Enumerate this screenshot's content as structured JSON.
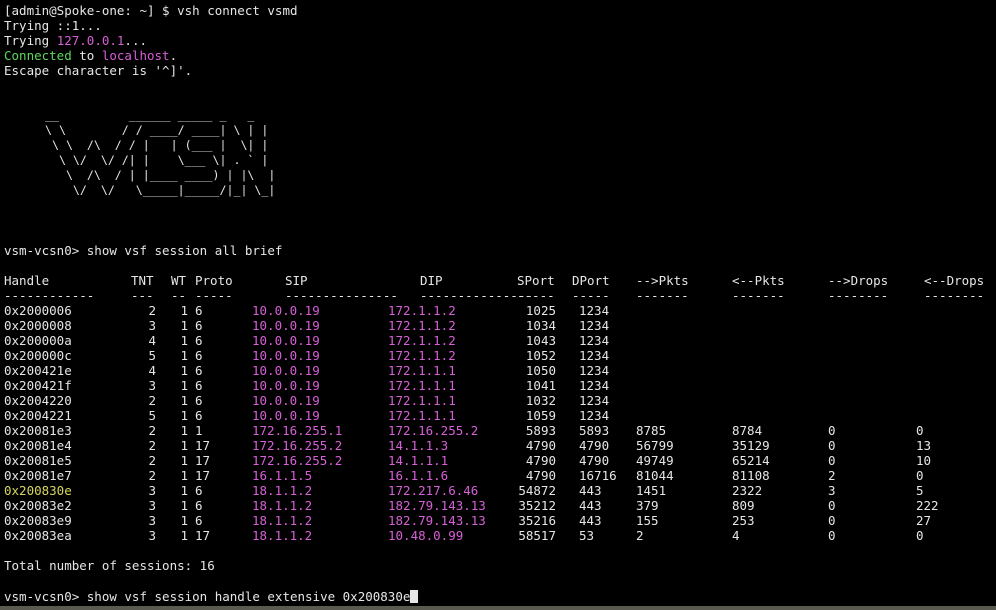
{
  "preamble": {
    "prompt": "[admin@Spoke-one: ~] $ vsh connect vsmd",
    "trying1": "Trying ::1...",
    "trying2_prefix": "Trying ",
    "trying2_ip": "127.0.0.1",
    "trying2_suffix": "...",
    "connected": "Connected",
    "connected_to": " to ",
    "localhost": "localhost",
    "period": ".",
    "escape": "Escape character is '^]'."
  },
  "banner": "__          ______ _____ _   _\n\\ \\        / / ____/ ____| \\ | |\n \\ \\  /\\  / / |   | (___ |  \\| |\n  \\ \\/  \\/ /| |    \\___ \\| . ` |\n   \\  /\\  / | |____ ____) | |\\  |\n    \\/  \\/   \\_____|_____/|_| \\_|",
  "command1": "vsm-vcsn0> show vsf session all brief",
  "table": {
    "headers": [
      "Handle",
      "TNT",
      "WT",
      "Proto",
      "SIP",
      "DIP",
      "SPort",
      "DPort",
      "-->Pkts",
      "<--Pkts",
      "-->Drops",
      "<--Drops"
    ],
    "separators": [
      "------------",
      "---",
      "--",
      "-----",
      "---------------",
      "---------------",
      "-----",
      "-----",
      "-------",
      "-------",
      "--------",
      "--------"
    ],
    "rows": [
      [
        "0x2000006",
        "2",
        "1",
        "6",
        "10.0.0.19",
        "172.1.1.2",
        "1025",
        "1234",
        "",
        "",
        "",
        ""
      ],
      [
        "0x2000008",
        "3",
        "1",
        "6",
        "10.0.0.19",
        "172.1.1.2",
        "1034",
        "1234",
        "",
        "",
        "",
        ""
      ],
      [
        "0x200000a",
        "4",
        "1",
        "6",
        "10.0.0.19",
        "172.1.1.2",
        "1043",
        "1234",
        "",
        "",
        "",
        ""
      ],
      [
        "0x200000c",
        "5",
        "1",
        "6",
        "10.0.0.19",
        "172.1.1.2",
        "1052",
        "1234",
        "",
        "",
        "",
        ""
      ],
      [
        "0x200421e",
        "4",
        "1",
        "6",
        "10.0.0.19",
        "172.1.1.1",
        "1050",
        "1234",
        "",
        "",
        "",
        ""
      ],
      [
        "0x200421f",
        "3",
        "1",
        "6",
        "10.0.0.19",
        "172.1.1.1",
        "1041",
        "1234",
        "",
        "",
        "",
        ""
      ],
      [
        "0x2004220",
        "2",
        "1",
        "6",
        "10.0.0.19",
        "172.1.1.1",
        "1032",
        "1234",
        "",
        "",
        "",
        ""
      ],
      [
        "0x2004221",
        "5",
        "1",
        "6",
        "10.0.0.19",
        "172.1.1.1",
        "1059",
        "1234",
        "",
        "",
        "",
        ""
      ],
      [
        "0x20081e3",
        "2",
        "1",
        "1",
        "172.16.255.1",
        "172.16.255.2",
        "5893",
        "5893",
        "8785",
        "8784",
        "0",
        "0"
      ],
      [
        "0x20081e4",
        "2",
        "1",
        "17",
        "172.16.255.2",
        "14.1.1.3",
        "4790",
        "4790",
        "56799",
        "35129",
        "0",
        "13"
      ],
      [
        "0x20081e5",
        "2",
        "1",
        "17",
        "172.16.255.2",
        "14.1.1.1",
        "4790",
        "4790",
        "49749",
        "65214",
        "0",
        "10"
      ],
      [
        "0x20081e7",
        "2",
        "1",
        "17",
        "16.1.1.5",
        "16.1.1.6",
        "4790",
        "16716",
        "81044",
        "81108",
        "2",
        "0"
      ],
      [
        "0x200830e",
        "3",
        "1",
        "6",
        "18.1.1.2",
        "172.217.6.46",
        "54872",
        "443",
        "1451",
        "2322",
        "3",
        "5"
      ],
      [
        "0x20083e2",
        "3",
        "1",
        "6",
        "18.1.1.2",
        "182.79.143.13",
        "35212",
        "443",
        "379",
        "809",
        "0",
        "222"
      ],
      [
        "0x20083e9",
        "3",
        "1",
        "6",
        "18.1.1.2",
        "182.79.143.13",
        "35216",
        "443",
        "155",
        "253",
        "0",
        "27"
      ],
      [
        "0x20083ea",
        "3",
        "1",
        "17",
        "18.1.1.2",
        "10.48.0.99",
        "58517",
        "53",
        "2",
        "4",
        "0",
        "0"
      ]
    ],
    "highlight_row": 12
  },
  "total": "Total number of sessions: 16",
  "command2": "vsm-vcsn0> show vsf session handle extensive 0x200830e",
  "colors": {
    "ip": "#d75fd7",
    "connected": "#5fd75f",
    "highlight_handle": "#d7d75f",
    "foreground": "#e6e6e6",
    "background": "#000000"
  }
}
